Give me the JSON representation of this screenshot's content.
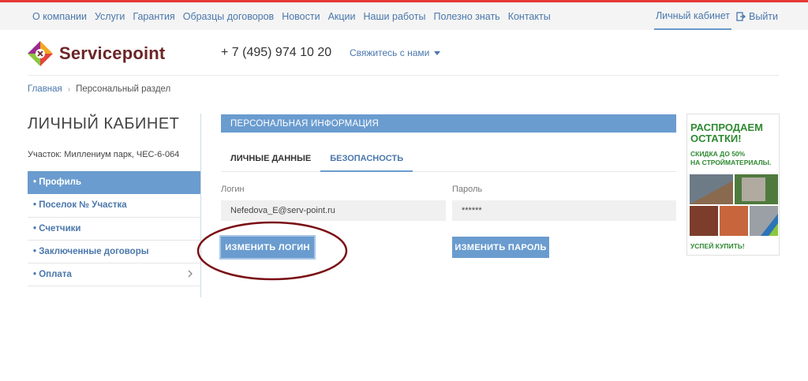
{
  "topnav": {
    "items": [
      {
        "label": "О компании"
      },
      {
        "label": "Услуги"
      },
      {
        "label": "Гарантия"
      },
      {
        "label": "Образцы договоров"
      },
      {
        "label": "Новости"
      },
      {
        "label": "Акции"
      },
      {
        "label": "Наши работы"
      },
      {
        "label": "Полезно знать"
      },
      {
        "label": "Контакты"
      }
    ],
    "cabinet_label": "Личный кабинет",
    "logout_label": "Выйти"
  },
  "header": {
    "logo_text": "Servicepoint",
    "phone": "+ 7 (495) 974 10 20",
    "contact_label": "Свяжитесь с нами"
  },
  "breadcrumb": {
    "home": "Главная",
    "separator": "›",
    "current": "Персональный раздел"
  },
  "sidebar": {
    "title": "ЛИЧНЫЙ КАБИНЕТ",
    "plot_info": "Участок: Миллениум парк, ЧЕС-6-064",
    "items": [
      {
        "label": "• Профиль"
      },
      {
        "label": "• Поселок № Участка"
      },
      {
        "label": "• Счетчики"
      },
      {
        "label": "• Заключенные договоры"
      },
      {
        "label": "• Оплата"
      }
    ]
  },
  "main": {
    "section_title": "ПЕРСОНАЛЬНАЯ ИНФОРМАЦИЯ",
    "tabs": [
      {
        "label": "ЛИЧНЫЕ ДАННЫЕ"
      },
      {
        "label": "БЕЗОПАСНОСТЬ"
      }
    ],
    "login_label": "Логин",
    "login_value": "Nefedova_E@serv-point.ru",
    "password_label": "Пароль",
    "password_value": "******",
    "change_login_button": "ИЗМЕНИТЬ ЛОГИН",
    "change_password_button": "ИЗМЕНИТЬ ПАРОЛЬ"
  },
  "ad": {
    "headline_1": "РАСПРОДАЕМ",
    "headline_2": "ОСТАТКИ!",
    "sub_1": "СКИДКА ДО 50%",
    "sub_2": "НА СТРОЙМАТЕРИАЛЫ.",
    "cta": "УСПЕЙ КУПИТЬ!"
  },
  "colors": {
    "accent": "#6a9ccf",
    "link": "#4a77ab",
    "brand": "#6b2527",
    "highlight": "#7a0f14",
    "ad_green": "#2f8a32"
  }
}
